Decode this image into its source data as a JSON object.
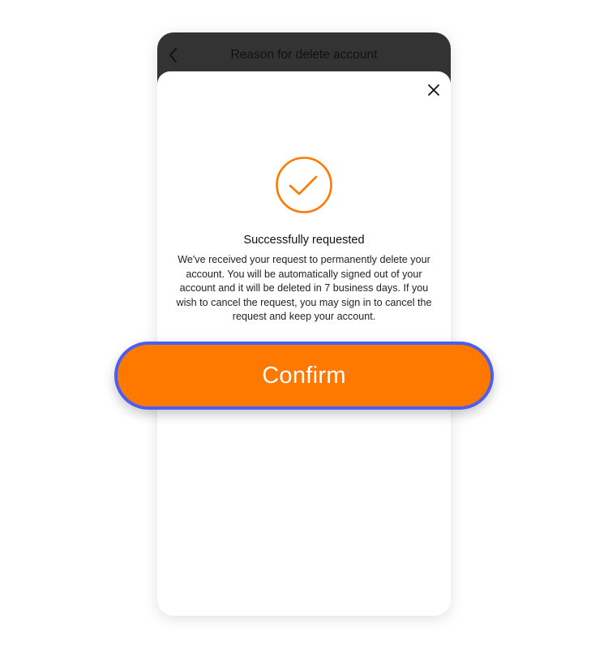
{
  "header": {
    "title": "Reason for delete account"
  },
  "dialog": {
    "title": "Successfully requested",
    "message": "We've received your request to permanently delete your account. You will be automatically signed out of your account and it will be deleted in 7 business days. If you wish to cancel the request, you may sign in to cancel the request and keep your account."
  },
  "actions": {
    "confirm_label": "Confirm"
  },
  "icons": {
    "back": "chevron-left-icon",
    "close": "close-icon",
    "success": "check-circle-icon"
  },
  "colors": {
    "accent": "#ff7800",
    "header_bg": "#333333",
    "focus_ring": "#4a5ff0"
  }
}
